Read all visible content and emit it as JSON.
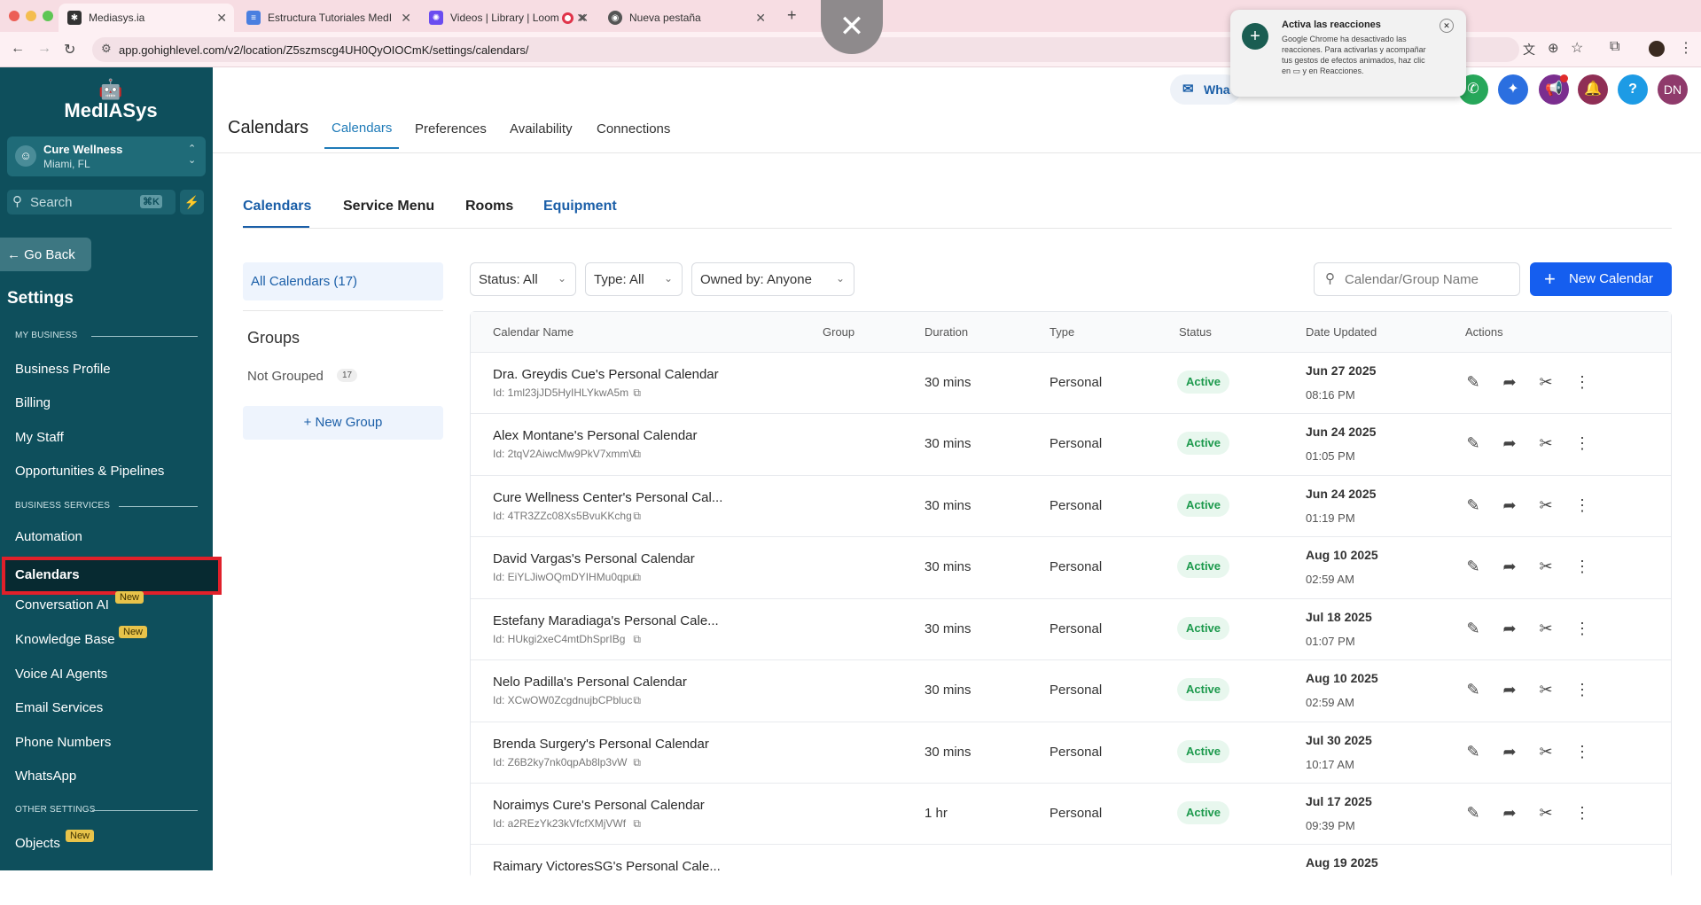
{
  "browser": {
    "tabs": [
      {
        "title": "Mediasys.ia",
        "favicon_color": "#333333"
      },
      {
        "title": "Estructura Tutoriales MedIAS",
        "favicon_color": "#4a7fe0"
      },
      {
        "title": "Videos | Library | Loom",
        "favicon_color": "#6a4cf0"
      },
      {
        "title": "",
        "favicon_color": "#e0344a"
      },
      {
        "title": "Nueva pestaña",
        "favicon_color": "#555555"
      }
    ],
    "url": "app.gohighlevel.com/v2/location/Z5szmscg4UH0QyOIOCmK/settings/calendars/",
    "notification": {
      "title": "Activa las reacciones",
      "body": "Google Chrome ha desactivado las reacciones. Para activarlas y acompañar tus gestos de efectos animados, haz clic en ▭ y en Reacciones."
    },
    "profile_initials": ""
  },
  "sidebar": {
    "logo": "MedIASys",
    "account": {
      "name": "Cure Wellness",
      "location": "Miami, FL"
    },
    "search": {
      "placeholder": "Search",
      "shortcut": "⌘K"
    },
    "go_back": "← Go Back",
    "title": "Settings",
    "sections": [
      {
        "header": "MY BUSINESS",
        "items": [
          "Business Profile",
          "Billing",
          "My Staff",
          "Opportunities & Pipelines"
        ]
      },
      {
        "header": "BUSINESS SERVICES",
        "items": [
          "Automation",
          "Calendars",
          "Conversation AI",
          "Knowledge Base",
          "Voice AI Agents",
          "Email Services",
          "Phone Numbers",
          "WhatsApp"
        ]
      },
      {
        "header": "OTHER SETTINGS",
        "items": [
          "Objects"
        ]
      }
    ],
    "new_badge": "New",
    "active_item": "Calendars"
  },
  "header": {
    "page_title": "Calendars",
    "tabs": [
      "Calendars",
      "Preferences",
      "Availability",
      "Connections"
    ],
    "active_tab": "Calendars",
    "whatsapp_label": "Wha",
    "user_initials": "DN"
  },
  "subtabs": [
    "Calendars",
    "Service Menu",
    "Rooms",
    "Equipment"
  ],
  "left_panel": {
    "all_calendars": "All Calendars (17)",
    "groups_title": "Groups",
    "not_grouped": "Not Grouped",
    "not_grouped_count": "17",
    "new_group": "+ New Group"
  },
  "filters": {
    "status": "Status: All",
    "type": "Type: All",
    "owned": "Owned by: Anyone",
    "search_placeholder": "Calendar/Group Name",
    "new_calendar": "New Calendar"
  },
  "table": {
    "headers": [
      "Calendar Name",
      "Group",
      "Duration",
      "Type",
      "Status",
      "Date Updated",
      "Actions"
    ],
    "rows": [
      {
        "name": "Dra. Greydis Cue's Personal Calendar",
        "id": "Id: 1ml23jJD5HyIHLYkwA5m",
        "duration": "30 mins",
        "type": "Personal",
        "status": "Active",
        "date": "Jun 27 2025",
        "time": "08:16 PM"
      },
      {
        "name": "Alex Montane's Personal Calendar",
        "id": "Id: 2tqV2AiwcMw9PkV7xmmV",
        "duration": "30 mins",
        "type": "Personal",
        "status": "Active",
        "date": "Jun 24 2025",
        "time": "01:05 PM"
      },
      {
        "name": "Cure Wellness Center's Personal Cal...",
        "id": "Id: 4TR3ZZc08Xs5BvuKKchg",
        "duration": "30 mins",
        "type": "Personal",
        "status": "Active",
        "date": "Jun 24 2025",
        "time": "01:19 PM"
      },
      {
        "name": "David Vargas's Personal Calendar",
        "id": "Id: EiYLJiwOQmDYIHMu0qpu",
        "duration": "30 mins",
        "type": "Personal",
        "status": "Active",
        "date": "Aug 10 2025",
        "time": "02:59 AM"
      },
      {
        "name": "Estefany Maradiaga's Personal Cale...",
        "id": "Id: HUkgi2xeC4mtDhSprIBg",
        "duration": "30 mins",
        "type": "Personal",
        "status": "Active",
        "date": "Jul 18 2025",
        "time": "01:07 PM"
      },
      {
        "name": "Nelo Padilla's Personal Calendar",
        "id": "Id: XCwOW0ZcgdnujbCPbluc",
        "duration": "30 mins",
        "type": "Personal",
        "status": "Active",
        "date": "Aug 10 2025",
        "time": "02:59 AM"
      },
      {
        "name": "Brenda Surgery's Personal Calendar",
        "id": "Id: Z6B2ky7nk0qpAb8lp3vW",
        "duration": "30 mins",
        "type": "Personal",
        "status": "Active",
        "date": "Jul 30 2025",
        "time": "10:17 AM"
      },
      {
        "name": "Noraimys Cure's Personal Calendar",
        "id": "Id: a2REzYk23kVfcfXMjVWf",
        "duration": "1 hr",
        "type": "Personal",
        "status": "Active",
        "date": "Jul 17 2025",
        "time": "09:39 PM"
      },
      {
        "name": "Raimary VictoresSG's Personal Cale...",
        "id": "",
        "duration": "",
        "type": "",
        "status": "",
        "date": "Aug 19 2025",
        "time": ""
      }
    ]
  },
  "colors": {
    "sidebar_bg": "#0e4f5c",
    "accent": "#155eef",
    "active_tab": "#1b5fa8",
    "highlight_box": "#e0202a",
    "status_green": "#1d9a4d"
  }
}
